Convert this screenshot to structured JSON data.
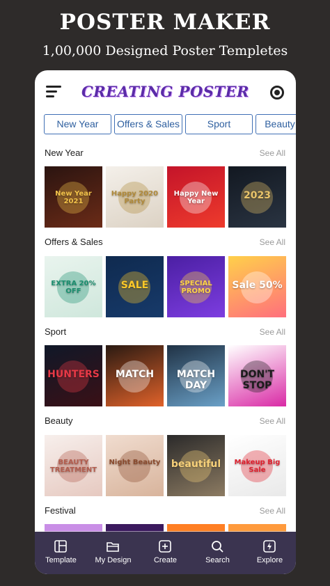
{
  "hero": {
    "title": "POSTER MAKER",
    "subtitle": "1,00,000 Designed Poster Templetes"
  },
  "appbar": {
    "title": "CREATING POSTER"
  },
  "tabs": [
    "New Year",
    "Offers & Sales",
    "Sport",
    "Beauty"
  ],
  "sections": [
    {
      "title": "New Year",
      "see_all": "See All",
      "posters": [
        {
          "text": "New Year 2021",
          "colors": [
            "#2b1410",
            "#6b2b17"
          ],
          "accent": "#f2c24a"
        },
        {
          "text": "Happy 2020 Party",
          "colors": [
            "#f4f0ea",
            "#dcd2c4"
          ],
          "accent": "#b08a3a"
        },
        {
          "text": "Happy New Year",
          "colors": [
            "#c4142a",
            "#ee3b2c"
          ],
          "accent": "#ffffff"
        },
        {
          "text": "2023",
          "colors": [
            "#121821",
            "#2a3442"
          ],
          "accent": "#e9c46a"
        }
      ]
    },
    {
      "title": "Offers & Sales",
      "see_all": "See All",
      "posters": [
        {
          "text": "EXTRA 20% OFF",
          "colors": [
            "#e9f4ee",
            "#cfe7dc"
          ],
          "accent": "#1b8f6f"
        },
        {
          "text": "SALE",
          "colors": [
            "#0f2a4f",
            "#173a6a"
          ],
          "accent": "#ffc928"
        },
        {
          "text": "SPECIAL PROMO",
          "colors": [
            "#4b1fa3",
            "#7d3de0"
          ],
          "accent": "#ffd447"
        },
        {
          "text": "Sale 50%",
          "colors": [
            "#ffd04a",
            "#ff6f7d"
          ],
          "accent": "#ffffff"
        }
      ]
    },
    {
      "title": "Sport",
      "see_all": "See All",
      "posters": [
        {
          "text": "HUNTERS",
          "colors": [
            "#101828",
            "#3a1016"
          ],
          "accent": "#e63946"
        },
        {
          "text": "MATCH",
          "colors": [
            "#2a1a12",
            "#e0622a"
          ],
          "accent": "#ffffff"
        },
        {
          "text": "MATCH DAY",
          "colors": [
            "#203245",
            "#6aa0c7"
          ],
          "accent": "#ffffff"
        },
        {
          "text": "DON'T STOP",
          "colors": [
            "#ffffff",
            "#d92aa5"
          ],
          "accent": "#1b1b1b"
        }
      ]
    },
    {
      "title": "Beauty",
      "see_all": "See All",
      "posters": [
        {
          "text": "BEAUTY TREATMENT",
          "colors": [
            "#f7efec",
            "#e6c9c0"
          ],
          "accent": "#b35d4e"
        },
        {
          "text": "Night Beauty",
          "colors": [
            "#f0dccf",
            "#d8b49c"
          ],
          "accent": "#8a4b2e"
        },
        {
          "text": "beautiful",
          "colors": [
            "#2b2a2a",
            "#8c7b62"
          ],
          "accent": "#f7d17a"
        },
        {
          "text": "Makeup Big Sale",
          "colors": [
            "#ffffff",
            "#e9e9e9"
          ],
          "accent": "#e0212f"
        }
      ]
    },
    {
      "title": "Festival",
      "see_all": "See All",
      "posters": [
        {
          "text": "",
          "colors": [
            "#c98ee6",
            "#ffffff"
          ],
          "accent": "#ffffff"
        },
        {
          "text": "",
          "colors": [
            "#3b1a5e",
            "#ffffff"
          ],
          "accent": "#ffffff"
        },
        {
          "text": "",
          "colors": [
            "#ff7f24",
            "#ffffff"
          ],
          "accent": "#ffffff"
        },
        {
          "text": "",
          "colors": [
            "#ff9a3c",
            "#ffffff"
          ],
          "accent": "#ffffff"
        }
      ]
    }
  ],
  "bottom_nav": [
    {
      "label": "Template",
      "icon": "template-icon"
    },
    {
      "label": "My Design",
      "icon": "folder-icon"
    },
    {
      "label": "Create",
      "icon": "plus-square-icon"
    },
    {
      "label": "Search",
      "icon": "search-icon"
    },
    {
      "label": "Explore",
      "icon": "compass-icon"
    }
  ],
  "colors": {
    "background": "#2e2b2a",
    "nav": "#3b3450",
    "tab_border": "#3f6fb5",
    "title_purple": "#5b2ca8"
  }
}
